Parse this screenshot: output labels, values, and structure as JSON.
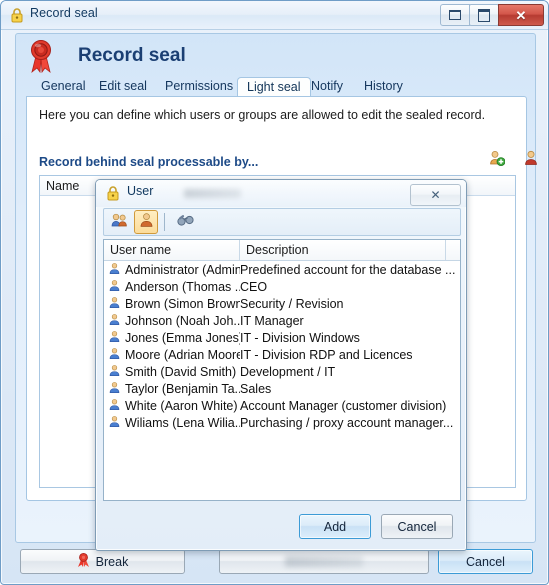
{
  "window": {
    "title": "Record seal",
    "header_title": "Record seal",
    "minimize_label": "Minimize",
    "maximize_label": "Maximize",
    "close_label": "✕",
    "accent_color": "#1d4a87",
    "close_color": "#b63b31"
  },
  "tabs": [
    {
      "label": "General",
      "active": false
    },
    {
      "label": "Edit seal",
      "active": false
    },
    {
      "label": "Permissions",
      "active": false
    },
    {
      "label": "Light seal",
      "active": true
    },
    {
      "label": "Notify",
      "active": false
    },
    {
      "label": "History",
      "active": false
    }
  ],
  "content": {
    "description": "Here you can define which users or groups are allowed to edit the sealed record.",
    "section_title": "Record behind seal processable by...",
    "list_header": "Name",
    "add_user_icon": "add-user-icon",
    "remove_user_icon": "remove-user-icon"
  },
  "footer": {
    "break_label": "Break",
    "cancel_label": "Cancel"
  },
  "user_dialog": {
    "title": "User",
    "close_label": "✕",
    "toolbar": [
      {
        "name": "groups-button",
        "icon": "group-icon",
        "selected": false
      },
      {
        "name": "users-button",
        "icon": "user-icon",
        "selected": true
      },
      {
        "name": "search-button",
        "icon": "binoculars-icon",
        "selected": false
      }
    ],
    "columns": [
      "User name",
      "Description"
    ],
    "rows": [
      {
        "user": "Administrator (Admin...",
        "description": "Predefined account for the database ..."
      },
      {
        "user": "Anderson (Thomas ...",
        "description": "CEO"
      },
      {
        "user": "Brown (Simon Brown)",
        "description": "Security / Revision"
      },
      {
        "user": "Johnson (Noah Joh...",
        "description": "IT Manager"
      },
      {
        "user": "Jones (Emma Jones)",
        "description": "IT - Division Windows"
      },
      {
        "user": "Moore (Adrian Moore)",
        "description": "IT - Division RDP and Licences"
      },
      {
        "user": "Smith (David Smith)",
        "description": "Development / IT"
      },
      {
        "user": "Taylor (Benjamin Ta...",
        "description": "Sales"
      },
      {
        "user": "White (Aaron White)",
        "description": "Account Manager (customer division)"
      },
      {
        "user": "Wiliams (Lena Wilia...",
        "description": "Purchasing / proxy account manager..."
      }
    ],
    "add_label": "Add",
    "cancel_label": "Cancel"
  }
}
